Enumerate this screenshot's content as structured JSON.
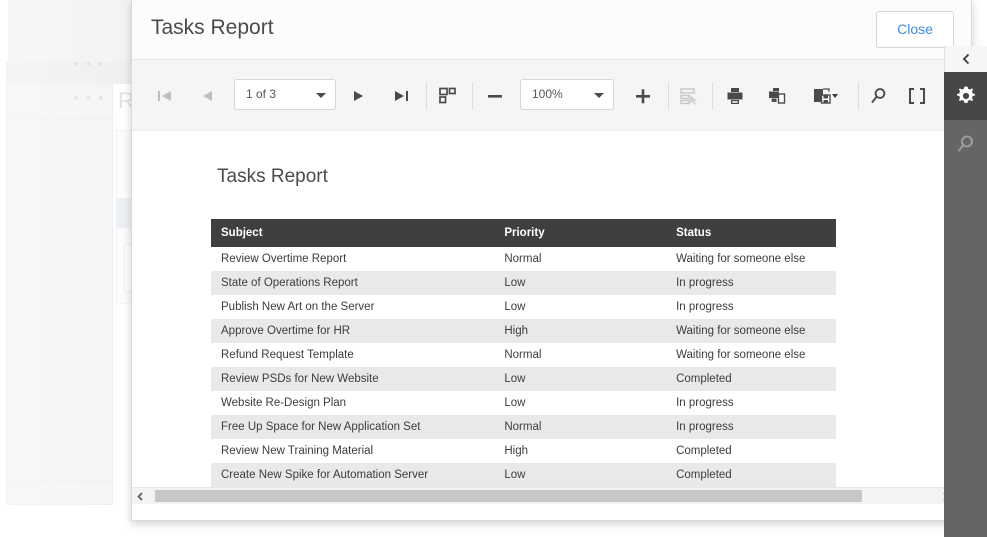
{
  "background": {
    "report_label": "R",
    "dots": "• • •"
  },
  "modal": {
    "title": "Tasks Report",
    "close_label": "Close"
  },
  "toolbar": {
    "first_page_icon": "first-page-icon",
    "prev_page_icon": "previous-page-icon",
    "page_selector_value": "1 of 3",
    "next_page_icon": "next-page-icon",
    "last_page_icon": "last-page-icon",
    "multipage_icon": "multipage-view-icon",
    "zoom_out_icon": "zoom-out-icon",
    "zoom_value": "100%",
    "zoom_in_icon": "zoom-in-icon",
    "interactive_sort_icon": "interactive-sort-icon",
    "print_icon": "print-icon",
    "print_page_icon": "print-page-icon",
    "export_icon": "export-icon",
    "search_icon": "search-icon",
    "fullscreen_icon": "fullscreen-icon"
  },
  "document": {
    "title": "Tasks Report",
    "table": {
      "columns": [
        "Subject",
        "Priority",
        "Status"
      ],
      "rows": [
        [
          "Review Overtime Report",
          "Normal",
          "Waiting for someone else"
        ],
        [
          "State of Operations Report",
          "Low",
          "In progress"
        ],
        [
          "Publish New Art on the Server",
          "Low",
          "In progress"
        ],
        [
          "Approve Overtime for HR",
          "High",
          "Waiting for someone else"
        ],
        [
          "Refund Request Template",
          "Normal",
          "Waiting for someone else"
        ],
        [
          "Review PSDs for New Website",
          "Low",
          "Completed"
        ],
        [
          "Website Re-Design Plan",
          "Low",
          "In progress"
        ],
        [
          "Free Up Space for New Application Set",
          "Normal",
          "In progress"
        ],
        [
          "Review New Training Material",
          "High",
          "Completed"
        ],
        [
          "Create New Spike for Automation Server",
          "Low",
          "Completed"
        ]
      ]
    }
  },
  "scrollbars": {
    "vertical_up_icon": "chevron-up-icon",
    "vertical_down_icon": "chevron-down-icon",
    "horizontal_left_icon": "chevron-left-icon",
    "horizontal_right_icon": "chevron-right-icon"
  },
  "rail": {
    "collapse_icon": "chevron-left-icon",
    "items": [
      {
        "icon": "gear-icon",
        "active": true
      },
      {
        "icon": "search-icon",
        "active": false
      }
    ]
  },
  "colors": {
    "table_header_bg": "#3f3f3f",
    "table_alt_row_bg": "#e9e9e9",
    "rail_bg": "#656565",
    "rail_active_bg": "#474747",
    "close_link": "#3d8bde"
  }
}
